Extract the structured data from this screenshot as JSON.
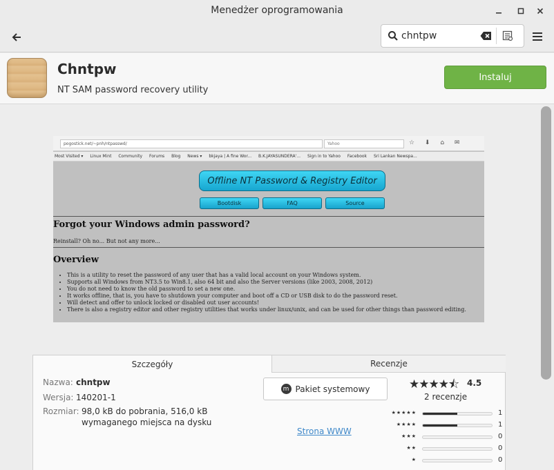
{
  "window": {
    "title": "Menedżer oprogramowania"
  },
  "toolbar": {
    "search_value": "chntpw"
  },
  "app": {
    "name": "Chntpw",
    "summary": "NT SAM password recovery utility",
    "install_label": "Instaluj"
  },
  "screenshot": {
    "url": "pogostick.net/~pnh/ntpasswd/",
    "search_engine": "Yahoo",
    "bookmarks": [
      "Most Visited ▾",
      "Linux Mint",
      "Community",
      "Forums",
      "Blog",
      "News ▾",
      "bkjaya | A fine Wor...",
      "B.K.JAYASUNDERA'...",
      "Sign in to Yahoo",
      "Facebook",
      "Sri Lankan Newspa..."
    ],
    "banner": "Offline NT Password & Registry Editor",
    "buttons": [
      "Bootdisk",
      "FAQ",
      "Source"
    ],
    "heading1": "Forgot your Windows admin password?",
    "para1": "Reinstall? Oh no... But not any more...",
    "heading2": "Overview",
    "bullets": [
      "This is a utility to reset the password of any user that has a valid local account on your Windows system.",
      "Supports all Windows from NT3.5 to Win8.1, also 64 bit and also the Server versions (like 2003, 2008, 2012)",
      "You do not need to know the old password to set a new one.",
      "It works offline, that is, you have to shutdown your computer and boot off a CD or USB disk to do the password reset.",
      "Will detect and offer to unlock locked or disabled out user accounts!",
      "There is also a registry editor and other registry utilities that works under linux/unix, and can be used for other things than password editing."
    ]
  },
  "details": {
    "tab_details": "Szczegóły",
    "tab_reviews": "Recenzje",
    "name_label": "Nazwa:",
    "name_value": "chntpw",
    "version_label": "Wersja:",
    "version_value": "140201-1",
    "size_label": "Rozmiar:",
    "size_line1": "98,0 kB do pobrania, 516,0 kB",
    "size_line2": "wymaganego miejsca na dysku",
    "package_label": "Pakiet systemowy",
    "website_label": "Strona WWW"
  },
  "rating": {
    "stars_display": "★★★★⯪",
    "value": "4.5",
    "count_label": "2 recenzje",
    "histogram": [
      {
        "stars": "★★★★★",
        "count": "1",
        "fraction": 0.5
      },
      {
        "stars": "★★★★",
        "count": "1",
        "fraction": 0.5
      },
      {
        "stars": "★★★",
        "count": "0",
        "fraction": 0
      },
      {
        "stars": "★★",
        "count": "0",
        "fraction": 0
      },
      {
        "stars": "★",
        "count": "0",
        "fraction": 0
      }
    ]
  }
}
